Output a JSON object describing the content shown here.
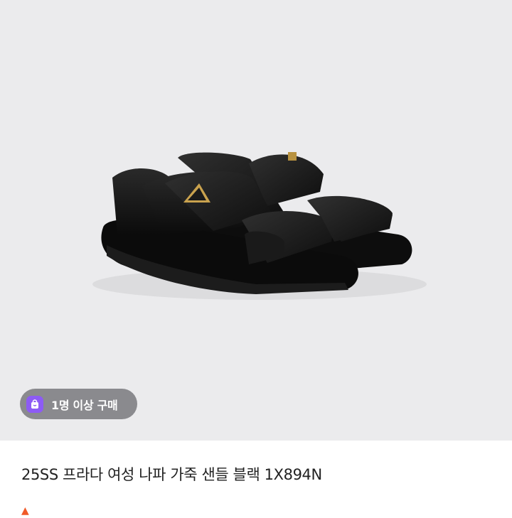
{
  "product": {
    "image_alt": "프라다 블랙 나파 가죽 샌들",
    "brand_tag": "PRADA"
  },
  "badge": {
    "icon": "shopping-bag-icon",
    "label": "1명 이상 구매",
    "color": "#8d5bf5"
  },
  "title": "25SS 프라다 여성 나파 가죽 샌들 블랙 1X894N",
  "meta": {
    "icon": "fire-icon",
    "text": ""
  },
  "colors": {
    "image_background": "#ebebed",
    "leather": "#141414",
    "logo_gold": "#b89240"
  }
}
